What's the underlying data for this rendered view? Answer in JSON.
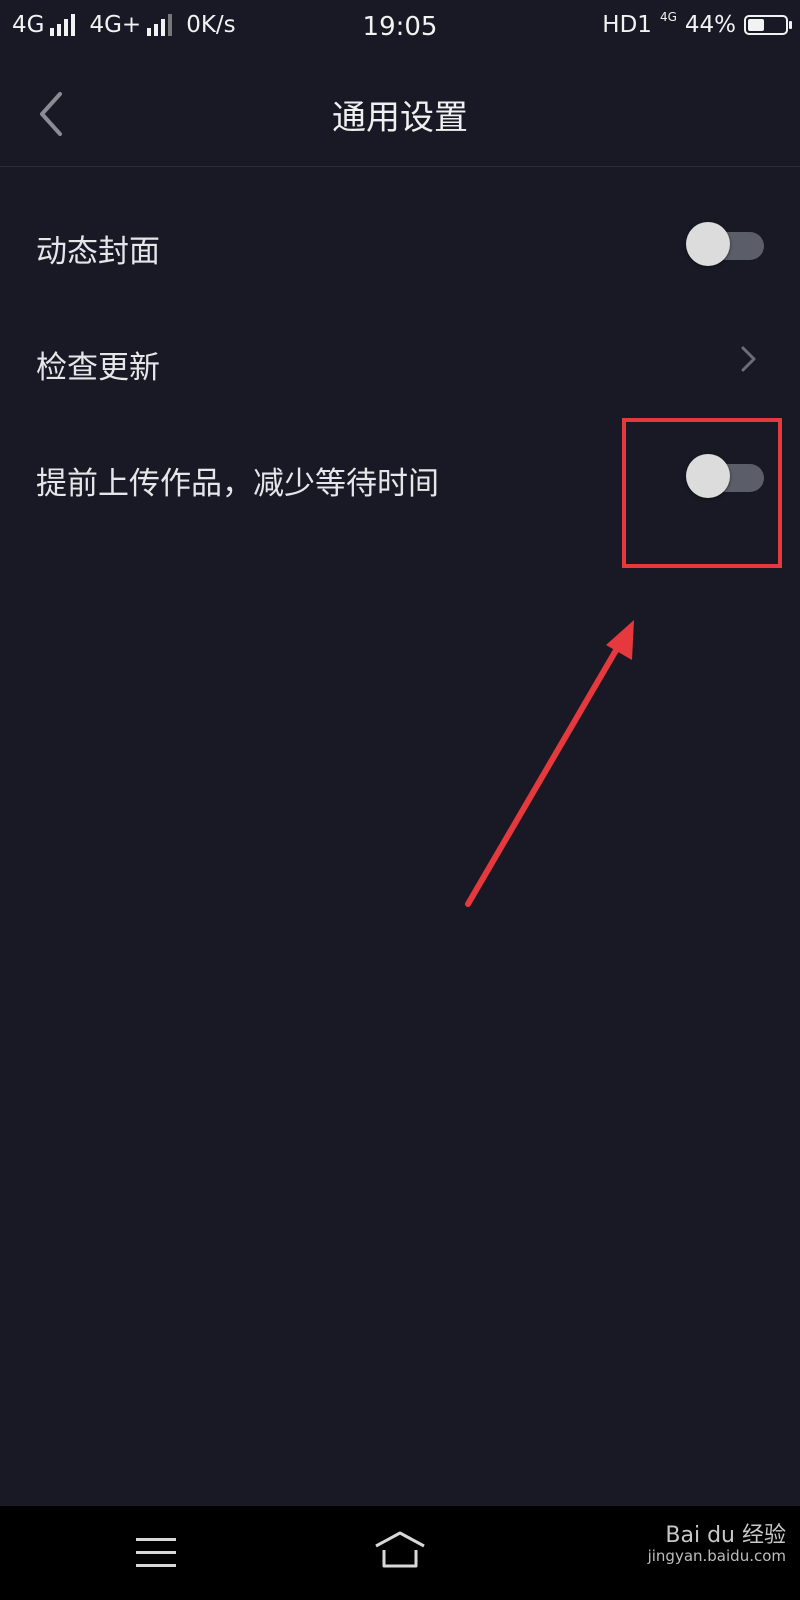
{
  "status_bar": {
    "network1": "4G",
    "network2": "4G+",
    "speed": "0K/s",
    "time": "19:05",
    "hd": "HD1",
    "hd_sup": "4G",
    "battery_percent": "44%",
    "battery_level": 0.44
  },
  "header": {
    "title": "通用设置"
  },
  "settings": {
    "items": [
      {
        "label": "动态封面",
        "control": "toggle",
        "on": false
      },
      {
        "label": "检查更新",
        "control": "chevron"
      },
      {
        "label": "提前上传作品，减少等待时间",
        "control": "toggle",
        "on": false
      }
    ]
  },
  "annotation": {
    "color": "#e5393e"
  },
  "watermark": {
    "brand": "Bai du 经验",
    "site": "jingyan.baidu.com"
  },
  "colors": {
    "background": "#181924",
    "toggle_track": "#5b5d68",
    "toggle_knob": "#dcdcdc"
  }
}
